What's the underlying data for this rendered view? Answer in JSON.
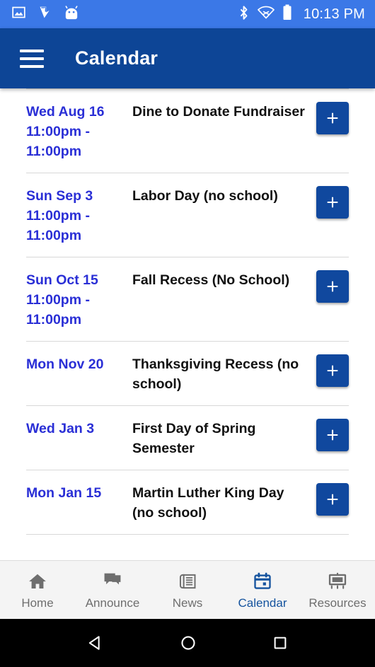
{
  "status_bar": {
    "left_icons": [
      "image-icon",
      "playstore-update-icon",
      "android-head-icon"
    ],
    "right_icons": [
      "bluetooth-icon",
      "wifi-off-icon",
      "battery-full-icon"
    ],
    "time": "10:13 PM",
    "background_color": "#3B78E7"
  },
  "app_bar": {
    "menu_icon": "hamburger-menu-icon",
    "title": "Calendar",
    "background_color": "#0D4596"
  },
  "calendar": {
    "add_button_label": "+",
    "add_button_color": "#10489E",
    "date_color": "#2A2FD6",
    "events": [
      {
        "date": "Wed Aug 16",
        "time": "11:00pm - 11:00pm",
        "title": "Dine to Donate Fundraiser"
      },
      {
        "date": "Sun Sep 3",
        "time": "11:00pm - 11:00pm",
        "title": "Labor Day (no school)"
      },
      {
        "date": "Sun Oct 15",
        "time": "11:00pm - 11:00pm",
        "title": "Fall Recess (No School)"
      },
      {
        "date": "Mon Nov 20",
        "time": "",
        "title": "Thanksgiving Recess (no school)"
      },
      {
        "date": "Wed Jan 3",
        "time": "",
        "title": "First Day of Spring Semester"
      },
      {
        "date": "Mon Jan 15",
        "time": "",
        "title": "Martin Luther King Day (no school)"
      }
    ]
  },
  "bottom_nav": {
    "active_color": "#15539E",
    "inactive_color": "#6E6E6E",
    "items": [
      {
        "label": "Home",
        "icon": "home-icon",
        "active": false
      },
      {
        "label": "Announce",
        "icon": "chat-bubbles-icon",
        "active": false
      },
      {
        "label": "News",
        "icon": "newspaper-icon",
        "active": false
      },
      {
        "label": "Calendar",
        "icon": "calendar-icon",
        "active": true
      },
      {
        "label": "Resources",
        "icon": "presentation-icon",
        "active": false
      }
    ]
  },
  "android_nav": {
    "back": "back-triangle-icon",
    "home": "home-circle-icon",
    "recents": "recents-square-icon"
  }
}
